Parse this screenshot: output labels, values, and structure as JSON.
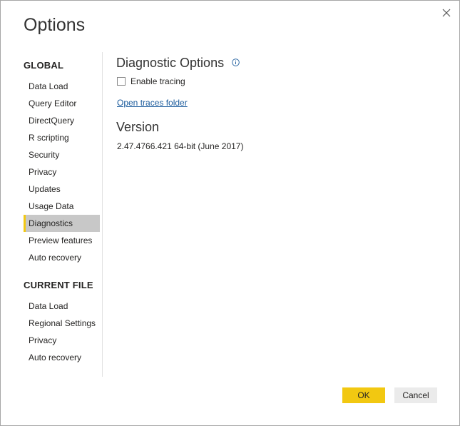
{
  "dialog": {
    "title": "Options",
    "close_icon": "close-icon"
  },
  "sidebar": {
    "global_header": "GLOBAL",
    "global_items": [
      {
        "label": "Data Load"
      },
      {
        "label": "Query Editor"
      },
      {
        "label": "DirectQuery"
      },
      {
        "label": "R scripting"
      },
      {
        "label": "Security"
      },
      {
        "label": "Privacy"
      },
      {
        "label": "Updates"
      },
      {
        "label": "Usage Data"
      },
      {
        "label": "Diagnostics",
        "selected": true
      },
      {
        "label": "Preview features"
      },
      {
        "label": "Auto recovery"
      }
    ],
    "current_file_header": "CURRENT FILE",
    "current_file_items": [
      {
        "label": "Data Load"
      },
      {
        "label": "Regional Settings"
      },
      {
        "label": "Privacy"
      },
      {
        "label": "Auto recovery"
      }
    ]
  },
  "content": {
    "diagnostic_heading": "Diagnostic Options",
    "info_icon": "info-icon",
    "enable_tracing_label": "Enable tracing",
    "enable_tracing_checked": false,
    "open_traces_link": "Open traces folder",
    "version_heading": "Version",
    "version_value": "2.47.4766.421 64-bit (June 2017)"
  },
  "buttons": {
    "ok_label": "OK",
    "cancel_label": "Cancel"
  },
  "colors": {
    "accent": "#f2c811",
    "selected_bg": "#c8c8c8",
    "link": "#1b5b9c"
  }
}
